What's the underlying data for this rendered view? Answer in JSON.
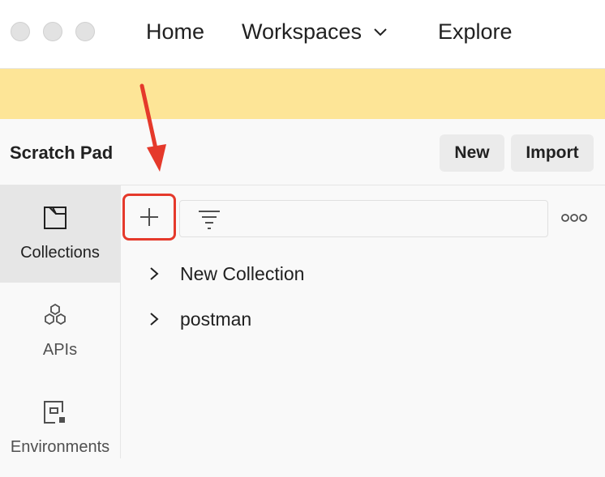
{
  "nav": {
    "home": "Home",
    "workspaces": "Workspaces",
    "explore": "Explore"
  },
  "workspace": {
    "title": "Scratch Pad",
    "new_label": "New",
    "import_label": "Import"
  },
  "sidebar": {
    "items": [
      {
        "label": "Collections",
        "icon": "collections-icon",
        "active": true
      },
      {
        "label": "APIs",
        "icon": "apis-icon",
        "active": false
      },
      {
        "label": "Environments",
        "icon": "environments-icon",
        "active": false
      }
    ]
  },
  "collections": [
    {
      "name": "New Collection"
    },
    {
      "name": "postman"
    }
  ],
  "colors": {
    "banner": "#fde597",
    "annotation": "#e5392b",
    "active_bg": "#e6e6e6"
  }
}
